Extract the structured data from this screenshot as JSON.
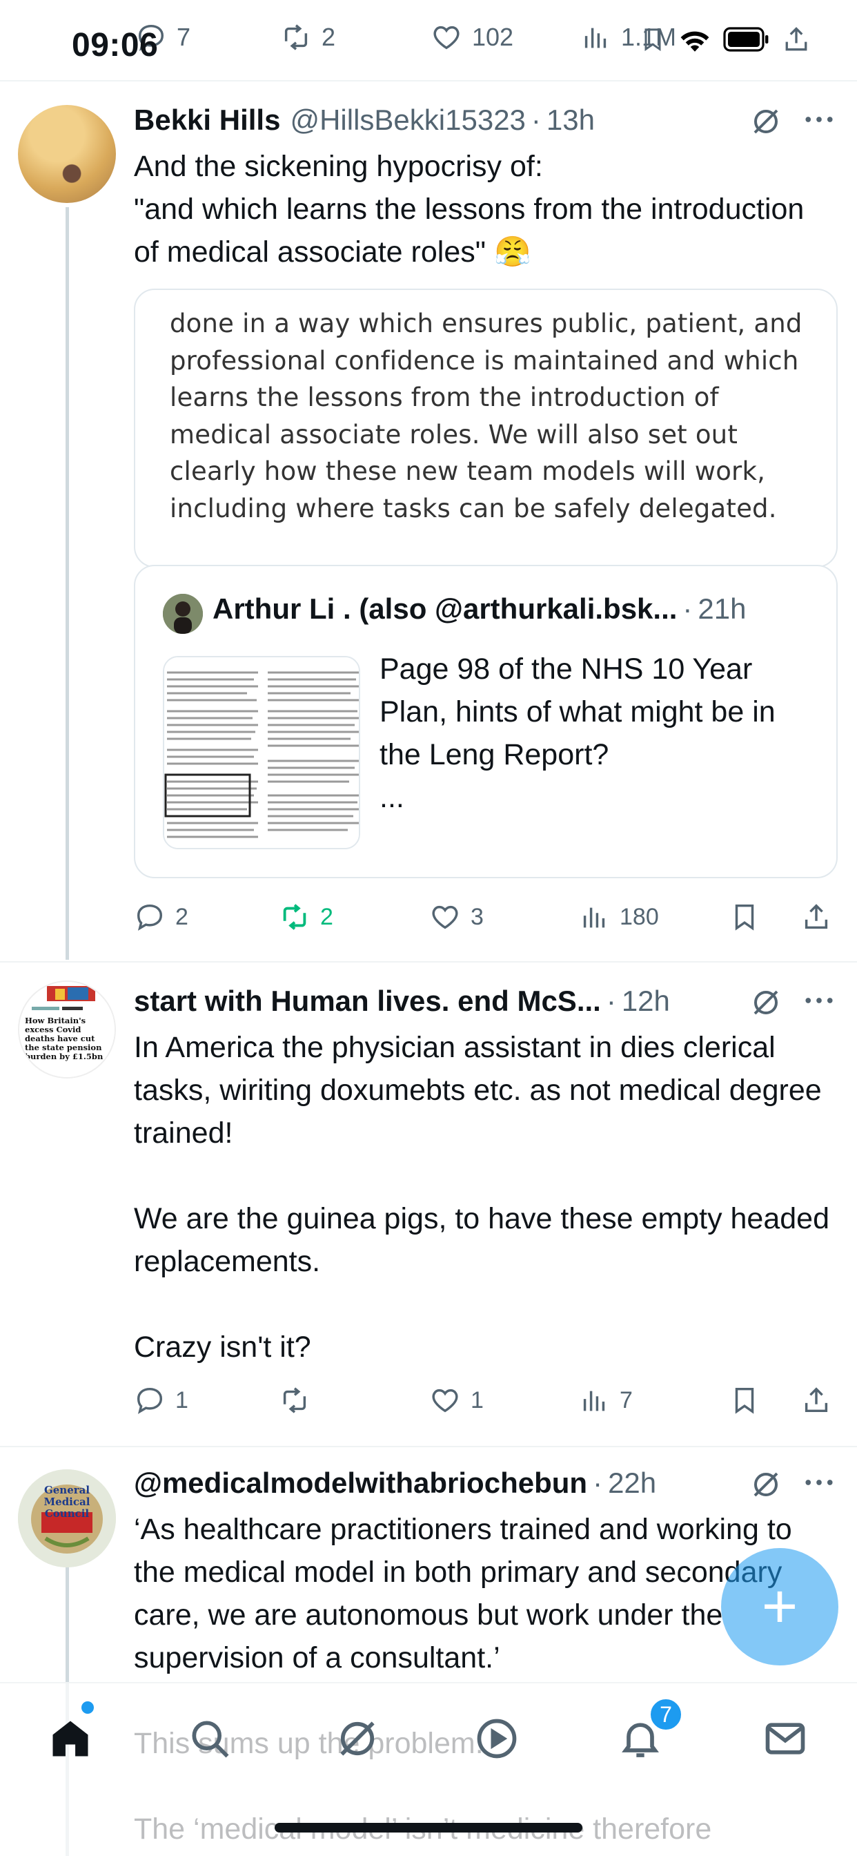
{
  "status_bar": {
    "time": "09:06"
  },
  "top_actions": {
    "replies": "7",
    "reposts": "2",
    "likes": "102",
    "views": "1.1M"
  },
  "tweets": [
    {
      "name": "Bekki Hills",
      "handle": "@HillsBekki15323",
      "time": "13h",
      "text": "And the sickening hypocrisy of:\n\"and which learns the lessons from the introduction of medical associate roles\" 😤",
      "image_text": "done in a way which ensures public, patient, and professional confidence is maintained and which learns the lessons from the introduction of medical associate roles. We will also set out clearly how these new team models will work, including where tasks can be safely delegated.",
      "quote": {
        "name": "Arthur Li . (also @arthurkali.bsk...",
        "time": "21h",
        "text": "Page 98 of the NHS 10 Year Plan, hints of what might be in the Leng Report?\n..."
      },
      "replies": "2",
      "reposts": "2",
      "likes": "3",
      "views": "180"
    },
    {
      "name": "start with Human lives. end McS...",
      "time": "12h",
      "avatar_headline": "How Britain's excess Covid deaths have cut the state pension burden by £1.5bn",
      "text": "In America the physician assistant in dies clerical tasks, wiriting doxumebts etc. as not medical degree trained!\n\nWe are the guinea pigs, to have these empty headed replacements.\n\nCrazy isn't it?",
      "replies": "1",
      "reposts": "",
      "likes": "1",
      "views": "7"
    },
    {
      "name": "@medicalmodelwithabriochebun",
      "time": "22h",
      "avatar_text": "General Medical Council",
      "text": "‘As healthcare practitioners trained and working to the medical model in both primary and secondary care, we are autonomous but work under the supervision of a consultant.’\n\nThis sums up the problem.\n\nThe ‘medical model’ isn’t medicine therefore"
    }
  ],
  "fab": {
    "label": "+"
  },
  "bottom_nav": {
    "notifications_badge": "7"
  }
}
